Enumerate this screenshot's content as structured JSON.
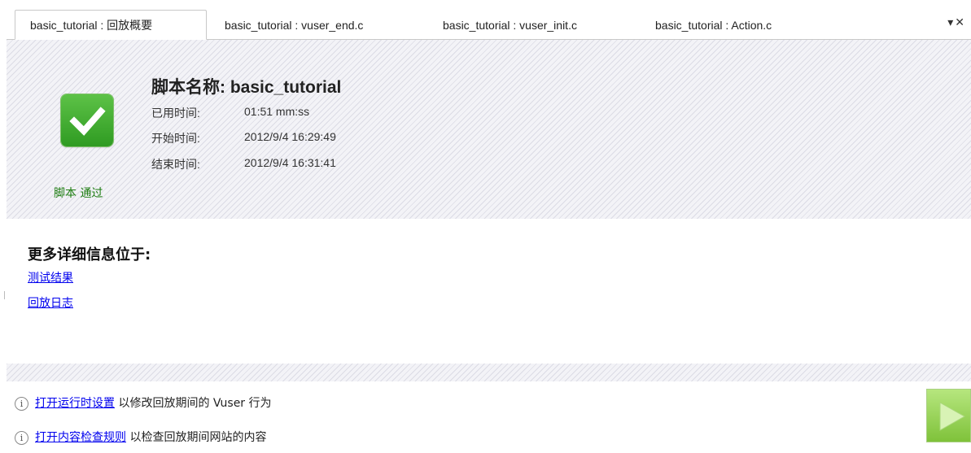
{
  "tabs": [
    {
      "label": "basic_tutorial : 回放概要",
      "active": true
    },
    {
      "label": "basic_tutorial : vuser_end.c",
      "active": false
    },
    {
      "label": "basic_tutorial : vuser_init.c",
      "active": false
    },
    {
      "label": "basic_tutorial : Action.c",
      "active": false
    }
  ],
  "tab_controls": {
    "menu_icon": "tab-list-icon",
    "close_icon": "close-icon",
    "glyphs": "▾✕"
  },
  "summary": {
    "status_icon": "check-icon",
    "status_label": "脚本 通过",
    "script_title": "脚本名称: basic_tutorial",
    "rows": [
      {
        "label": "已用时间:",
        "value": "01:51 mm:ss"
      },
      {
        "label": "开始时间:",
        "value": "2012/9/4 16:29:49"
      },
      {
        "label": "结束时间:",
        "value": "2012/9/4 16:31:41"
      }
    ]
  },
  "more_info": {
    "title": "更多详细信息位于:",
    "links": [
      "测试结果",
      "回放日志"
    ]
  },
  "tips": [
    {
      "icon": "info-icon",
      "link": "打开运行时设置",
      "text": " 以修改回放期间的 Vuser 行为"
    },
    {
      "icon": "info-icon",
      "link": "打开内容检查规则",
      "text": " 以检查回放期间网站的内容"
    }
  ],
  "play_button": {
    "icon": "play-icon",
    "color": "#8fcf4a"
  }
}
